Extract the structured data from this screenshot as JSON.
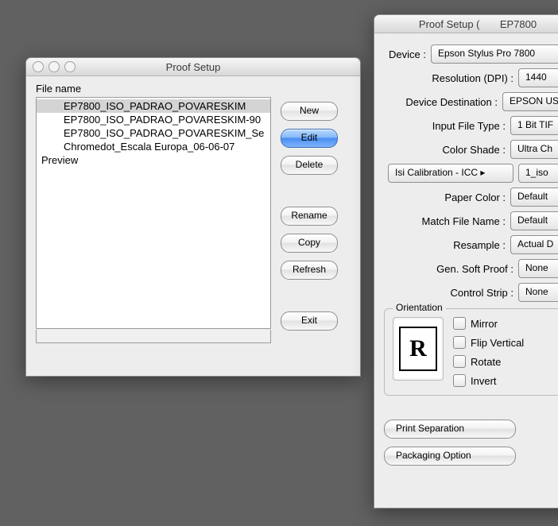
{
  "leftWindow": {
    "title": "Proof Setup",
    "fileNameLabel": "File name",
    "files": [
      {
        "label": "EP7800_ISO_PADRAO_POVARESKIM",
        "indent": true,
        "selected": true
      },
      {
        "label": "EP7800_ISO_PADRAO_POVARESKIM-90",
        "indent": true,
        "selected": false
      },
      {
        "label": "EP7800_ISO_PADRAO_POVARESKIM_Se",
        "indent": true,
        "selected": false
      },
      {
        "label": "Chromedot_Escala Europa_06-06-07",
        "indent": true,
        "selected": false
      },
      {
        "label": "Preview",
        "indent": false,
        "selected": false
      }
    ],
    "buttons": {
      "new": "New",
      "edit": "Edit",
      "delete": "Delete",
      "rename": "Rename",
      "copy": "Copy",
      "refresh": "Refresh",
      "exit": "Exit"
    }
  },
  "rightWindow": {
    "titlePrefix": "Proof Setup (",
    "titleSuffix": "EP7800",
    "fields": {
      "deviceLabel": "Device :",
      "deviceValue": "Epson Stylus Pro 7800",
      "resolutionLabel": "Resolution (DPI) :",
      "resolutionValue": "1440",
      "destLabel": "Device Destination :",
      "destValue": "EPSON US",
      "inputTypeLabel": "Input File Type :",
      "inputTypeValue": "1 Bit TIF",
      "shadeLabel": "Color Shade :",
      "shadeValue": "Ultra Ch",
      "calibLabel": "Isi Calibration - ICC ▸",
      "calibValue": "1_iso",
      "paperLabel": "Paper Color :",
      "paperValue": "Default",
      "matchLabel": "Match File Name :",
      "matchValue": "Default",
      "resampleLabel": "Resample :",
      "resampleValue": "Actual D",
      "softProofLabel": "Gen. Soft Proof :",
      "softProofValue": "None",
      "stripLabel": "Control Strip :",
      "stripValue": "None"
    },
    "orientation": {
      "legend": "Orientation",
      "previewLetter": "R",
      "mirror": "Mirror",
      "flipVertical": "Flip Vertical",
      "rotate": "Rotate",
      "invert": "Invert"
    },
    "bottom": {
      "printSeparation": "Print Separation",
      "packagingOption": "Packaging Option"
    }
  }
}
